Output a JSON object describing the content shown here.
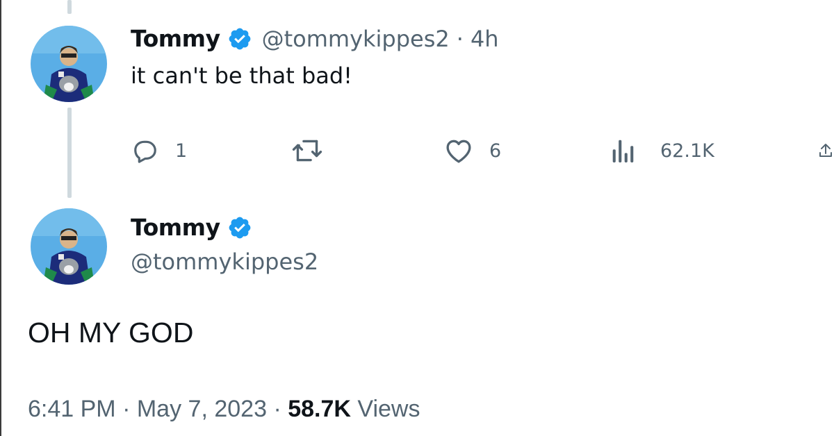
{
  "parent_tweet": {
    "display_name": "Tommy",
    "handle": "@tommykippes2",
    "separator": "·",
    "time_ago": "4h",
    "text": "it can't be that bad!",
    "actions": {
      "reply_count": "1",
      "retweet_count": "",
      "like_count": "6",
      "view_count": "62.1K"
    }
  },
  "main_tweet": {
    "display_name": "Tommy",
    "handle": "@tommykippes2",
    "text": "OH MY GOD",
    "time": "6:41 PM",
    "separator1": "·",
    "date": "May 7, 2023",
    "separator2": "·",
    "views_count": "58.7K",
    "views_label": "Views"
  },
  "icons": {
    "verified": "verified-badge-icon",
    "reply": "reply-icon",
    "retweet": "retweet-icon",
    "like": "heart-icon",
    "views": "analytics-icon",
    "share": "share-icon"
  },
  "colors": {
    "verified_blue": "#1d9bf0",
    "secondary_text": "#536471",
    "primary_text": "#0f1419",
    "thread_line": "#cfd9de"
  }
}
